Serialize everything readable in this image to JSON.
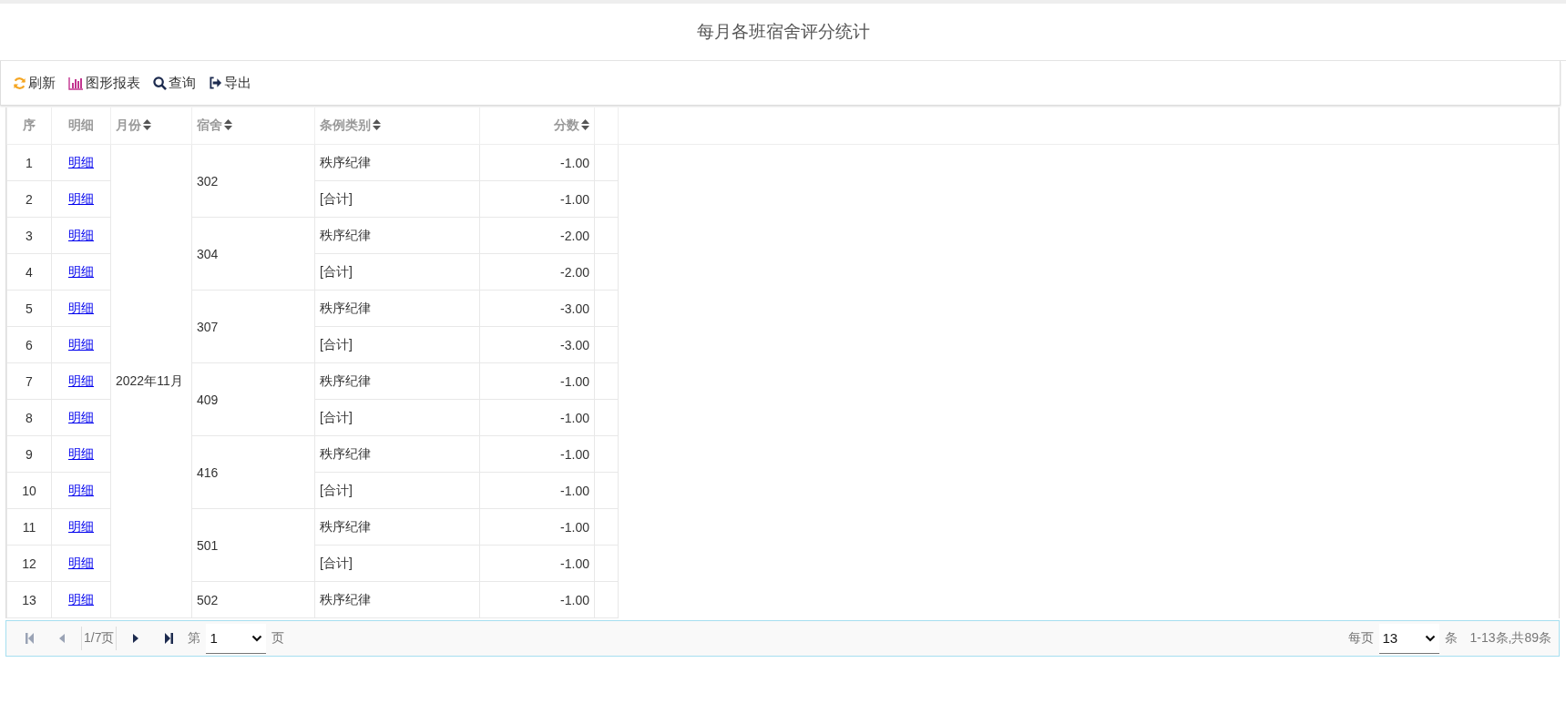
{
  "title": "每月各班宿舍评分统计",
  "toolbar": [
    {
      "kind": "refresh",
      "label": "刷新"
    },
    {
      "kind": "chart",
      "label": "图形报表"
    },
    {
      "kind": "search",
      "label": "查询"
    },
    {
      "kind": "export",
      "label": "导出"
    }
  ],
  "table": {
    "columns": [
      {
        "label": "序",
        "sortable": false
      },
      {
        "label": "明细",
        "sortable": false
      },
      {
        "label": "月份",
        "sortable": true
      },
      {
        "label": "宿舍",
        "sortable": true
      },
      {
        "label": "条例类别",
        "sortable": true
      },
      {
        "label": "分数",
        "sortable": true
      }
    ],
    "months": [
      {
        "month": "2022年11月",
        "dorms": [
          {
            "dorm": "302",
            "rows": [
              {
                "seq": "1",
                "link": "明细",
                "category": "秩序纪律",
                "score": "-1.00"
              },
              {
                "seq": "2",
                "link": "明细",
                "category": "[合计]",
                "score": "-1.00"
              }
            ]
          },
          {
            "dorm": "304",
            "rows": [
              {
                "seq": "3",
                "link": "明细",
                "category": "秩序纪律",
                "score": "-2.00"
              },
              {
                "seq": "4",
                "link": "明细",
                "category": "[合计]",
                "score": "-2.00"
              }
            ]
          },
          {
            "dorm": "307",
            "rows": [
              {
                "seq": "5",
                "link": "明细",
                "category": "秩序纪律",
                "score": "-3.00"
              },
              {
                "seq": "6",
                "link": "明细",
                "category": "[合计]",
                "score": "-3.00"
              }
            ]
          },
          {
            "dorm": "409",
            "rows": [
              {
                "seq": "7",
                "link": "明细",
                "category": "秩序纪律",
                "score": "-1.00"
              },
              {
                "seq": "8",
                "link": "明细",
                "category": "[合计]",
                "score": "-1.00"
              }
            ]
          },
          {
            "dorm": "416",
            "rows": [
              {
                "seq": "9",
                "link": "明细",
                "category": "秩序纪律",
                "score": "-1.00"
              },
              {
                "seq": "10",
                "link": "明细",
                "category": "[合计]",
                "score": "-1.00"
              }
            ]
          },
          {
            "dorm": "501",
            "rows": [
              {
                "seq": "11",
                "link": "明细",
                "category": "秩序纪律",
                "score": "-1.00"
              },
              {
                "seq": "12",
                "link": "明细",
                "category": "[合计]",
                "score": "-1.00"
              }
            ]
          },
          {
            "dorm": "502",
            "rows": [
              {
                "seq": "13",
                "link": "明细",
                "category": "秩序纪律",
                "score": "-1.00"
              }
            ]
          }
        ]
      }
    ]
  },
  "pager": {
    "first_disabled": true,
    "prev_disabled": true,
    "next_disabled": false,
    "last_disabled": false,
    "page_info": "1/7页",
    "goto_prefix": "第",
    "page_value": "1",
    "goto_suffix": "页",
    "per_page_prefix": "每页",
    "per_page_value": "13",
    "per_page_suffix": "条",
    "summary": "1-13条,共89条"
  }
}
